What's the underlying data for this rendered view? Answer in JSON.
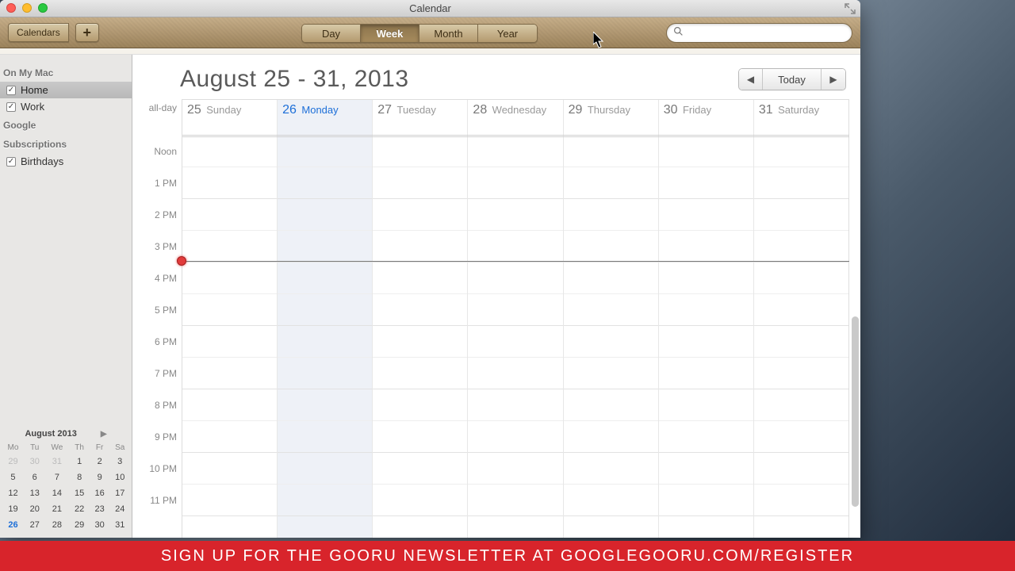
{
  "window": {
    "title": "Calendar"
  },
  "toolbar": {
    "calendars_label": "Calendars",
    "plus_label": "+",
    "views": [
      "Day",
      "Week",
      "Month",
      "Year"
    ],
    "active_view": "Week",
    "search_placeholder": ""
  },
  "sidebar": {
    "sections": [
      {
        "title": "On My Mac",
        "items": [
          {
            "label": "Home",
            "checked": true,
            "selected": true
          },
          {
            "label": "Work",
            "checked": true,
            "selected": false
          }
        ]
      },
      {
        "title": "Google",
        "items": []
      },
      {
        "title": "Subscriptions",
        "items": [
          {
            "label": "Birthdays",
            "checked": true,
            "selected": false
          }
        ]
      }
    ]
  },
  "minical": {
    "title": "August 2013",
    "dow": [
      "Mo",
      "Tu",
      "We",
      "Th",
      "Fr",
      "Sa"
    ],
    "rows": [
      [
        "29",
        "30",
        "31",
        "1",
        "2",
        "3"
      ],
      [
        "5",
        "6",
        "7",
        "8",
        "9",
        "10"
      ],
      [
        "12",
        "13",
        "14",
        "15",
        "16",
        "17"
      ],
      [
        "19",
        "20",
        "21",
        "22",
        "23",
        "24"
      ],
      [
        "26",
        "27",
        "28",
        "29",
        "30",
        "31"
      ]
    ],
    "dim_first_row_count": 3,
    "today": "26"
  },
  "main": {
    "title": "August 25 - 31, 2013",
    "today_label": "Today",
    "allday_label": "all-day",
    "days": [
      {
        "num": "25",
        "name": "Sunday",
        "today": false
      },
      {
        "num": "26",
        "name": "Monday",
        "today": true
      },
      {
        "num": "27",
        "name": "Tuesday",
        "today": false
      },
      {
        "num": "28",
        "name": "Wednesday",
        "today": false
      },
      {
        "num": "29",
        "name": "Thursday",
        "today": false
      },
      {
        "num": "30",
        "name": "Friday",
        "today": false
      },
      {
        "num": "31",
        "name": "Saturday",
        "today": false
      }
    ],
    "hours": [
      "Noon",
      "1 PM",
      "2 PM",
      "3 PM",
      "4 PM",
      "5 PM",
      "6 PM",
      "7 PM",
      "8 PM",
      "9 PM",
      "10 PM",
      "11 PM"
    ],
    "now_hour_index": 4
  },
  "banner": {
    "text": "SIGN UP FOR THE GOORU NEWSLETTER AT GOOGLEGOORU.COM/REGISTER"
  }
}
